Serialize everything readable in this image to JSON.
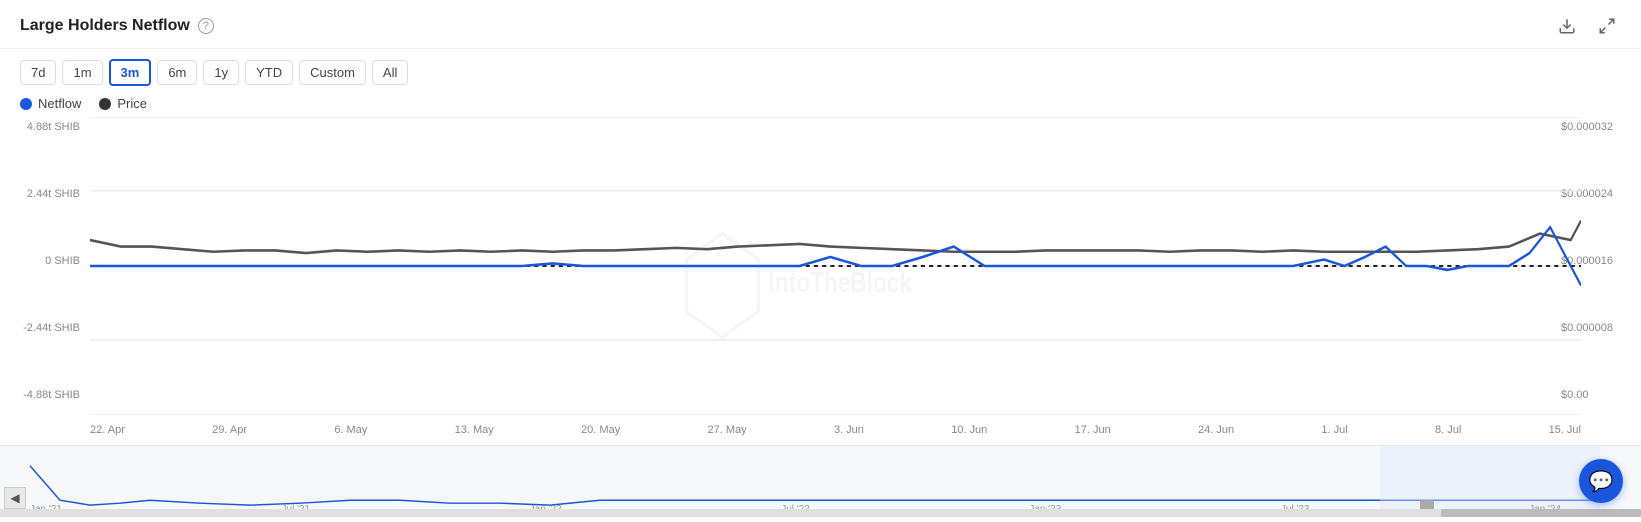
{
  "header": {
    "title": "Large Holders Netflow",
    "help_icon": "?",
    "download_icon": "⬇",
    "expand_icon": "⛶"
  },
  "toolbar": {
    "buttons": [
      {
        "label": "7d",
        "active": false
      },
      {
        "label": "1m",
        "active": false
      },
      {
        "label": "3m",
        "active": true
      },
      {
        "label": "6m",
        "active": false
      },
      {
        "label": "1y",
        "active": false
      },
      {
        "label": "YTD",
        "active": false
      },
      {
        "label": "Custom",
        "active": false
      },
      {
        "label": "All",
        "active": false
      }
    ]
  },
  "legend": [
    {
      "label": "Netflow",
      "color": "#1a56db"
    },
    {
      "label": "Price",
      "color": "#333"
    }
  ],
  "yaxis_left": [
    "4.88t SHIB",
    "2.44t SHIB",
    "0 SHIB",
    "-2.44t SHIB",
    "-4.88t SHIB"
  ],
  "yaxis_right": [
    "$0.000032",
    "$0.000024",
    "$0.000016",
    "$0.000008",
    "$0.00"
  ],
  "xaxis": [
    "22. Apr",
    "29. Apr",
    "6. May",
    "13. May",
    "20. May",
    "27. May",
    "3. Jun",
    "10. Jun",
    "17. Jun",
    "24. Jun",
    "1. Jul",
    "8. Jul",
    "15. Jul"
  ],
  "minimap_xaxis": [
    "Jan '21",
    "Jul '21",
    "Jan '22",
    "Jul '22",
    "Jan '23",
    "Jul '23",
    "Jan '24"
  ],
  "watermark": "IntoTheBlock"
}
